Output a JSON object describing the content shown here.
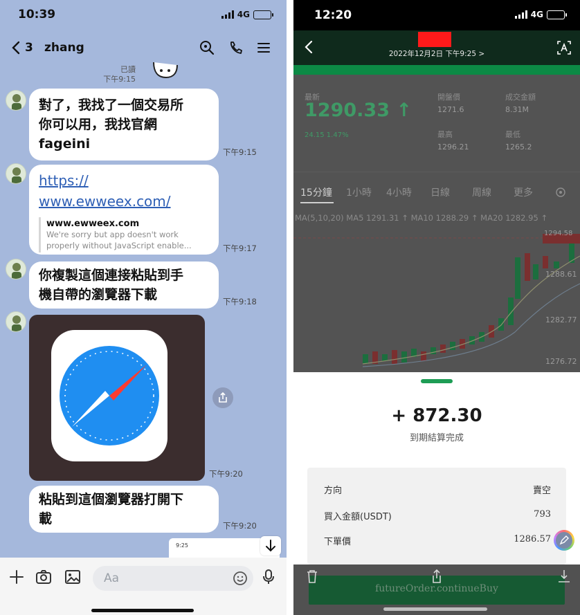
{
  "left": {
    "status": {
      "time": "10:39",
      "network": "4G"
    },
    "header": {
      "back_count": "3",
      "name": "zhang"
    },
    "read_receipt": {
      "status": "已讀",
      "time": "下午9:15"
    },
    "messages": [
      {
        "text": "對了，我找了一個交易所\n你可以用，我找官網\nfageini",
        "time": "下午9:15"
      },
      {
        "link": "https://\nwww.ewweex.com/",
        "preview_domain": "www.ewweex.com",
        "preview_desc": "We're sorry but app doesn't work\nproperly without JavaScript enable...",
        "time": "下午9:17"
      },
      {
        "text": "你複製這個連接粘貼到手\n機自帶的瀏覽器下載",
        "time": "下午9:18"
      },
      {
        "image": "safari-app-icon",
        "time": "下午9:20"
      },
      {
        "text": "粘貼到這個瀏覽器打開下\n載",
        "time": "下午9:20"
      }
    ],
    "thumb_time": "9:25",
    "input_placeholder": "Aa"
  },
  "right": {
    "status": {
      "time": "12:20",
      "network": "4G"
    },
    "header": {
      "date": "2022年12月2日 下午9:25 >"
    },
    "overlay": {
      "label_price": "最新",
      "price": "1290.33 ↑",
      "pct": "24.15  1.47%",
      "label_open": "開盤價",
      "open": "1271.6",
      "label_vol": "成交金額",
      "vol": "8.31M",
      "label_high": "最高",
      "high": "1296.21",
      "label_low": "最低",
      "low": "1265.2",
      "tabs": [
        "15分鐘",
        "1小時",
        "4小時",
        "日線",
        "周線",
        "更多"
      ],
      "ma_line": "MA(5,10,20)   MA5 1291.31 ↑   MA10 1288.29 ↑   MA20 1282.95 ↑",
      "axis": [
        "1294.58",
        "1288.61",
        "1282.77",
        "1276.72"
      ]
    },
    "profit": "+ 872.30",
    "profit_label": "到期結算完成",
    "details": [
      {
        "label": "方向",
        "value": "賣空"
      },
      {
        "label": "買入金額(USDT)",
        "value": "793"
      },
      {
        "label": "下單價",
        "value": "1286.57"
      }
    ],
    "cta": "futureOrder.continueBuy"
  },
  "colors": {
    "chat_bg": "#a5b8dc",
    "brand_green": "#1e9d55",
    "link": "#2e5fb5",
    "redaction": "#ff1a1a"
  }
}
